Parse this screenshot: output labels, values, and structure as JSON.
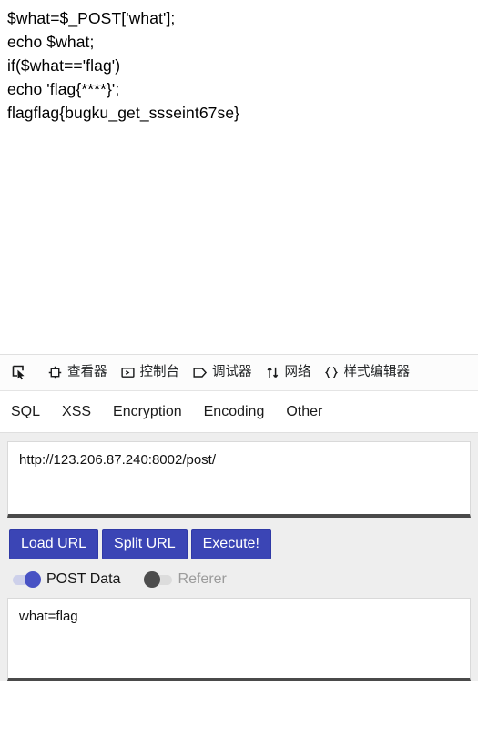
{
  "page": {
    "php_output_lines": [
      "$what=$_POST['what'];",
      "echo $what;",
      "if($what=='flag')",
      "echo 'flag{****}';",
      "flagflag{bugku_get_ssseint67se}"
    ]
  },
  "devtools": {
    "picker_icon": "element-picker-icon",
    "tabs": [
      {
        "label": "查看器",
        "icon": "inspector-icon",
        "selected": false
      },
      {
        "label": "控制台",
        "icon": "console-icon",
        "selected": false
      },
      {
        "label": "调试器",
        "icon": "debugger-icon",
        "selected": false
      },
      {
        "label": "网络",
        "icon": "network-icon",
        "selected": false
      },
      {
        "label": "样式编辑器",
        "icon": "style-editor-icon",
        "selected": false
      }
    ]
  },
  "hackbar": {
    "tabs": [
      {
        "label": "SQL"
      },
      {
        "label": "XSS"
      },
      {
        "label": "Encryption"
      },
      {
        "label": "Encoding"
      },
      {
        "label": "Other"
      }
    ],
    "url_field": {
      "value": "http://123.206.87.240:8002/post/",
      "placeholder": "URL"
    },
    "buttons": [
      {
        "label": "Load URL"
      },
      {
        "label": "Split URL"
      },
      {
        "label": "Execute!"
      }
    ],
    "toggles": [
      {
        "label": "POST Data",
        "on": true
      },
      {
        "label": "Referer",
        "on": false
      }
    ],
    "post_field": {
      "value": "what=flag",
      "placeholder": "POST data"
    }
  },
  "colors": {
    "button_blue": "#3b45b5",
    "toggle_on": "#4852c4",
    "toggle_off": "#4d4d4d",
    "panel_bg": "#eeeeee",
    "page_bg": "#ffffff"
  }
}
